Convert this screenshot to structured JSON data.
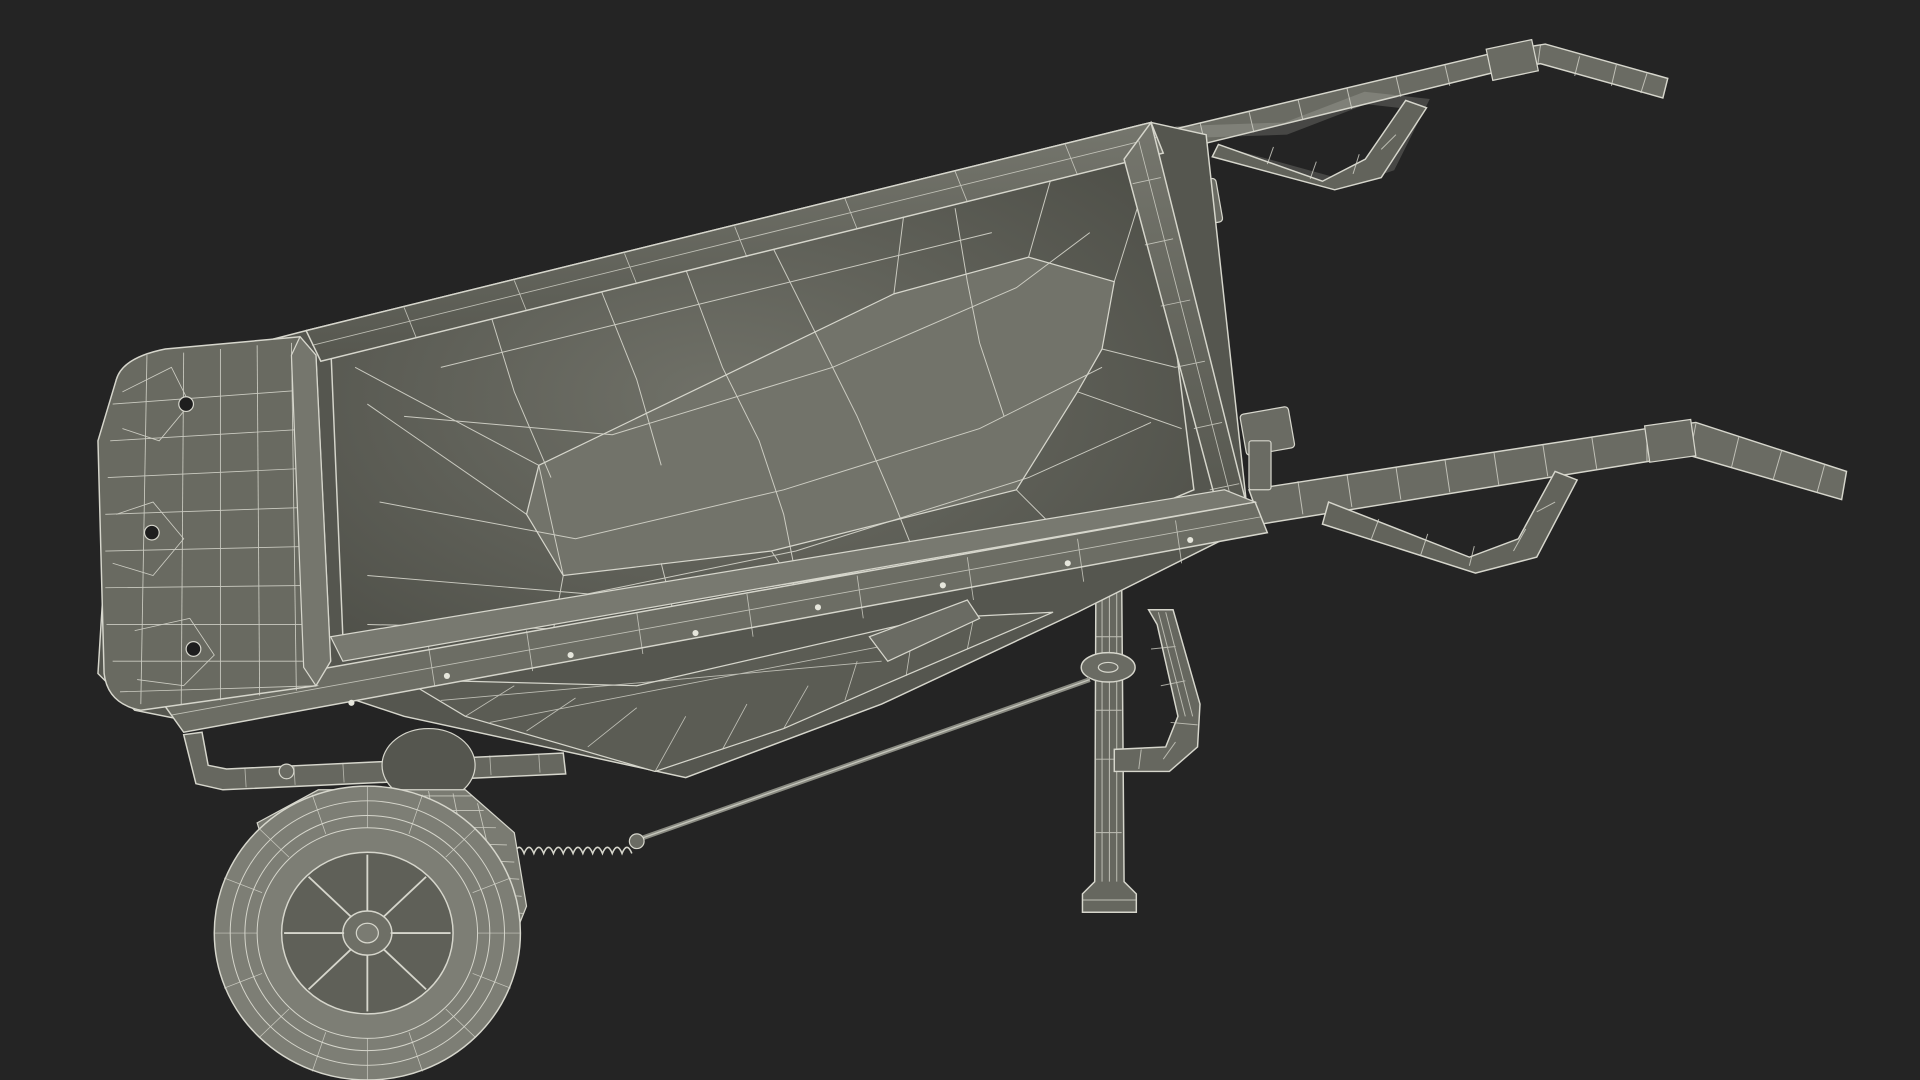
{
  "scene": {
    "background_color": "#242424",
    "object": "wheelbarrow",
    "render_style": "wireframe over solid",
    "colors": {
      "shell": "#5d5e55",
      "shell_dark": "#4a4b44",
      "shell_light": "#6e6f66",
      "wire": "#d6d6cc",
      "metal": "#7a7b72"
    }
  }
}
